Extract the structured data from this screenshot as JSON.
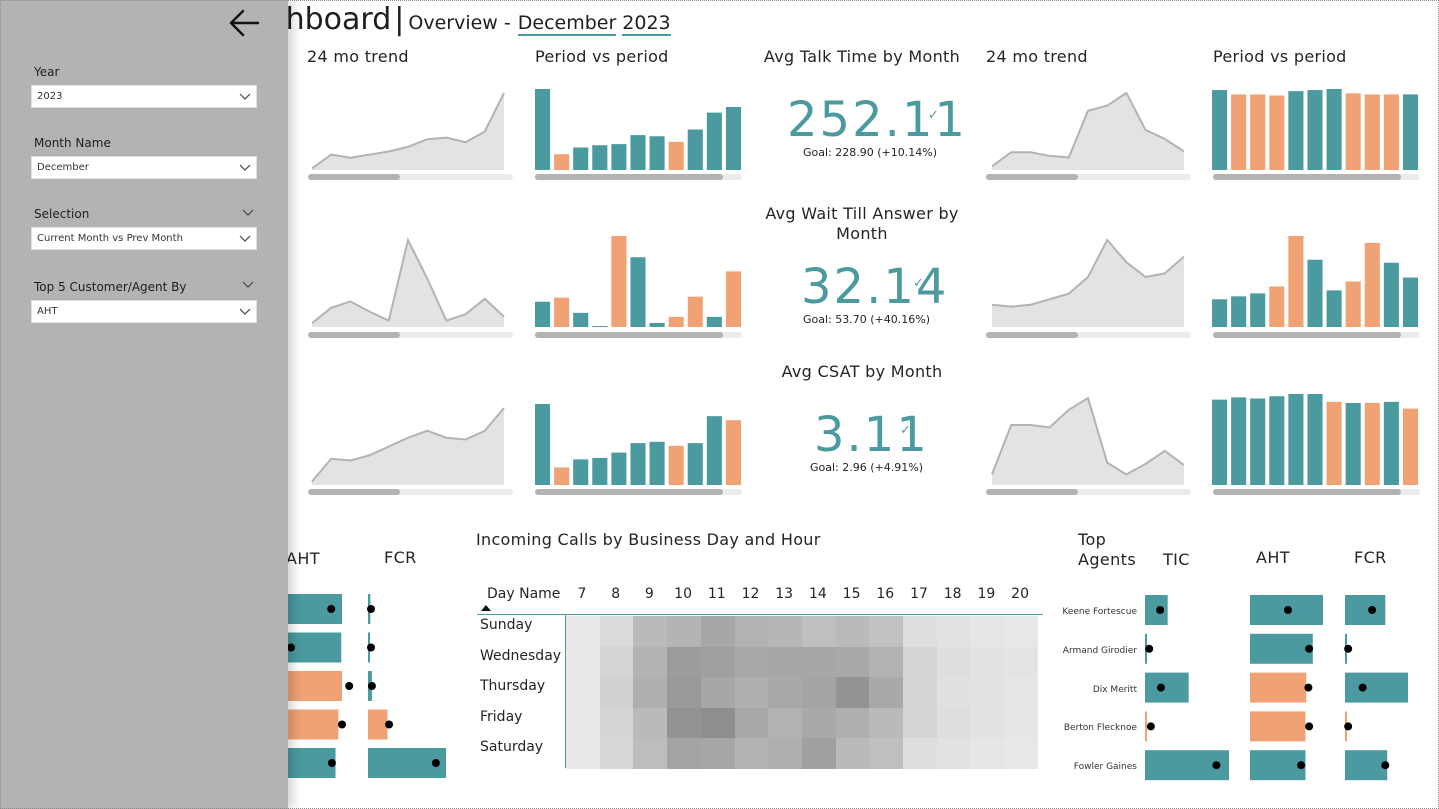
{
  "header": {
    "title": "shboard",
    "separator": "|",
    "subtitle": "Overview -",
    "month": "December",
    "year": "2023"
  },
  "filters": {
    "year_label": "Year",
    "year_value": "2023",
    "month_label": "Month Name",
    "month_value": "December",
    "selection_label": "Selection",
    "selection_value": "Current Month vs Prev Month",
    "top5_label": "Top 5 Customer/Agent By",
    "top5_value": "AHT"
  },
  "left_group": {
    "trend_title": "24 mo trend",
    "period_title": "Period vs period"
  },
  "right_group": {
    "trend_title": "24 mo trend",
    "period_title": "Period vs period"
  },
  "kpis": [
    {
      "title": "Avg Talk Time by Month",
      "value": "252.11",
      "goal": "Goal: 228.90 (+10.14%)"
    },
    {
      "title": "Avg Wait Till Answer by Month",
      "value": "32.14",
      "goal": "Goal: 53.70 (+40.16%)"
    },
    {
      "title": "Avg CSAT by Month",
      "value": "3.11",
      "goal": "Goal: 2.96 (+4.91%)"
    }
  ],
  "colors": {
    "teal": "#4a9aa0",
    "orange": "#f0a274",
    "area_fill": "#e3e3e3",
    "area_line": "#b3b3b3",
    "pane": "#b3b3b3"
  },
  "chart_data": [
    {
      "type": "area",
      "id": "trend-left-1",
      "values": [
        1,
        10,
        8,
        10,
        12,
        15,
        20,
        21,
        18,
        25,
        50
      ]
    },
    {
      "type": "bar",
      "id": "period-left-1",
      "values": [
        72,
        14,
        20,
        22,
        23,
        31,
        30,
        25,
        36,
        51,
        56
      ],
      "colors": [
        "teal",
        "orange",
        "teal",
        "teal",
        "teal",
        "teal",
        "teal",
        "orange",
        "teal",
        "teal",
        "teal"
      ]
    },
    {
      "type": "area",
      "id": "trend-left-2",
      "values": [
        3,
        15,
        20,
        12,
        5,
        68,
        38,
        5,
        10,
        22,
        8
      ]
    },
    {
      "type": "bar",
      "id": "period-left-2",
      "values": [
        25,
        29,
        14,
        1,
        90,
        69,
        4,
        10,
        30,
        10,
        55
      ],
      "colors": [
        "teal",
        "orange",
        "teal",
        "teal",
        "orange",
        "teal",
        "teal",
        "orange",
        "orange",
        "teal",
        "orange"
      ]
    },
    {
      "type": "area",
      "id": "trend-left-3",
      "values": [
        2,
        15,
        14,
        17,
        22,
        27,
        31,
        27,
        26,
        31,
        44
      ]
    },
    {
      "type": "bar",
      "id": "period-left-3",
      "values": [
        60,
        13,
        19,
        20,
        24,
        31,
        32,
        29,
        31,
        51,
        48
      ],
      "colors": [
        "teal",
        "orange",
        "teal",
        "teal",
        "teal",
        "teal",
        "teal",
        "orange",
        "teal",
        "teal",
        "orange"
      ]
    },
    {
      "type": "area",
      "id": "trend-right-1",
      "values": [
        5,
        24,
        24,
        19,
        17,
        80,
        87,
        104,
        54,
        42,
        25
      ]
    },
    {
      "type": "bar",
      "id": "period-right-1",
      "values": [
        74,
        70,
        70,
        69,
        73,
        74,
        75,
        71,
        70,
        70,
        70
      ],
      "colors": [
        "teal",
        "orange",
        "orange",
        "orange",
        "teal",
        "teal",
        "teal",
        "orange",
        "orange",
        "orange",
        "teal"
      ]
    },
    {
      "type": "area",
      "id": "trend-right-2",
      "values": [
        12,
        11,
        12,
        15,
        18,
        27,
        47,
        35,
        27,
        29,
        38
      ]
    },
    {
      "type": "bar",
      "id": "period-right-2",
      "values": [
        28,
        31,
        34,
        41,
        92,
        68,
        37,
        46,
        85,
        65,
        50
      ],
      "colors": [
        "teal",
        "teal",
        "teal",
        "orange",
        "orange",
        "teal",
        "teal",
        "orange",
        "orange",
        "teal",
        "teal"
      ]
    },
    {
      "type": "area",
      "id": "trend-right-3",
      "values": [
        9,
        51,
        51,
        49,
        64,
        74,
        19,
        9,
        18,
        29,
        17
      ]
    },
    {
      "type": "bar",
      "id": "period-right-3",
      "values": [
        76,
        78,
        77,
        79,
        81,
        81,
        74,
        73,
        73,
        74,
        68
      ],
      "colors": [
        "teal",
        "teal",
        "teal",
        "teal",
        "teal",
        "teal",
        "orange",
        "teal",
        "orange",
        "teal",
        "orange"
      ]
    },
    {
      "type": "heatmap",
      "id": "incoming-calls",
      "title": "Incoming Calls by Business Day and Hour",
      "row_header": "Day Name",
      "columns": [
        "7",
        "8",
        "9",
        "10",
        "11",
        "12",
        "13",
        "14",
        "15",
        "16",
        "17",
        "18",
        "19",
        "20"
      ],
      "rows": [
        "Sunday",
        "Wednesday",
        "Thursday",
        "Friday",
        "Saturday"
      ],
      "values": [
        [
          0.02,
          0.15,
          0.45,
          0.5,
          0.62,
          0.52,
          0.48,
          0.4,
          0.45,
          0.38,
          0.12,
          0.08,
          0.05,
          0.03
        ],
        [
          0.03,
          0.2,
          0.5,
          0.72,
          0.68,
          0.6,
          0.62,
          0.62,
          0.6,
          0.52,
          0.2,
          0.12,
          0.08,
          0.06
        ],
        [
          0.03,
          0.25,
          0.55,
          0.75,
          0.62,
          0.55,
          0.6,
          0.65,
          0.8,
          0.6,
          0.2,
          0.1,
          0.08,
          0.05
        ],
        [
          0.03,
          0.2,
          0.45,
          0.8,
          0.85,
          0.6,
          0.52,
          0.6,
          0.55,
          0.45,
          0.2,
          0.12,
          0.08,
          0.05
        ],
        [
          0.02,
          0.18,
          0.42,
          0.65,
          0.62,
          0.5,
          0.55,
          0.68,
          0.45,
          0.4,
          0.12,
          0.08,
          0.05,
          0.03
        ]
      ]
    }
  ],
  "left_table": {
    "aht_header": "AHT",
    "fcr_header": "FCR",
    "aht": [
      {
        "v": 0.75,
        "t": 0.6,
        "c": "teal"
      },
      {
        "v": 0.74,
        "t": 0.0,
        "c": "teal"
      },
      {
        "v": 0.75,
        "t": 0.85,
        "c": "orange"
      },
      {
        "v": 0.7,
        "t": 0.75,
        "c": "orange"
      },
      {
        "v": 0.66,
        "t": 0.61,
        "c": "teal"
      }
    ],
    "fcr": [
      {
        "v": 0.03,
        "t": 0.03,
        "c": "teal"
      },
      {
        "v": 0.02,
        "t": 0.02,
        "c": "teal"
      },
      {
        "v": 0.05,
        "t": 0.05,
        "c": "teal"
      },
      {
        "v": 0.25,
        "t": 0.27,
        "c": "orange"
      },
      {
        "v": 1.0,
        "t": 0.87,
        "c": "teal"
      }
    ]
  },
  "top_agents": {
    "title": "Top Agents",
    "tic_header": "TIC",
    "aht_header": "AHT",
    "fcr_header": "FCR",
    "agents": [
      "Keene Fortescue",
      "Armand Girodier",
      "Dix Meritt",
      "Berton Flecknoe",
      "Fowler Gaines"
    ],
    "tic": [
      {
        "v": 0.27,
        "t": 0.18
      },
      {
        "v": 0.02,
        "t": 0.05
      },
      {
        "v": 0.52,
        "t": 0.19
      },
      {
        "v": 0.01,
        "t": 0.07
      },
      {
        "v": 1.0,
        "t": 0.85
      }
    ],
    "aht": [
      {
        "v": 1.0,
        "t": 0.52,
        "c": "teal"
      },
      {
        "v": 0.86,
        "t": 0.81,
        "c": "teal"
      },
      {
        "v": 0.77,
        "t": 0.8,
        "c": "orange"
      },
      {
        "v": 0.76,
        "t": 0.81,
        "c": "orange"
      },
      {
        "v": 0.76,
        "t": 0.7,
        "c": "teal"
      }
    ],
    "fcr": [
      {
        "v": 0.64,
        "t": 0.43,
        "c": "teal"
      },
      {
        "v": 0.0,
        "t": 0.05,
        "c": "teal"
      },
      {
        "v": 1.0,
        "t": 0.28,
        "c": "teal"
      },
      {
        "v": 0.01,
        "t": 0.05,
        "c": "orange"
      },
      {
        "v": 0.67,
        "t": 0.64,
        "c": "teal"
      }
    ]
  }
}
